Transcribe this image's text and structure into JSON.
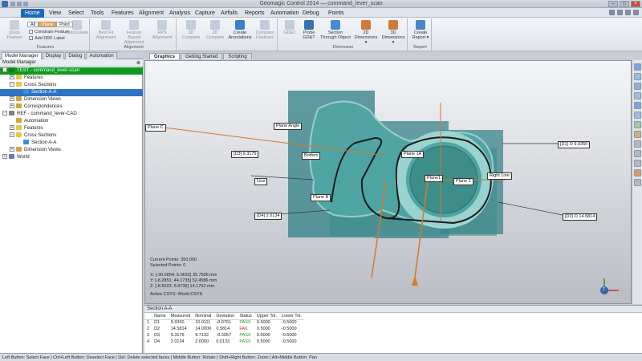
{
  "window": {
    "title": "Geomagic Control 2014 — command_lever_scan"
  },
  "menu": {
    "tabs": [
      "Home",
      "View",
      "Select",
      "Tools",
      "Features",
      "Alignment",
      "Analysis",
      "Capture",
      "Airfoils",
      "Reports",
      "Automation",
      "Debug",
      "Points"
    ],
    "active": "Home"
  },
  "ribbon": {
    "groups": [
      {
        "label": "Features",
        "buttons": [
          "Quick Feature",
          "AutoCreate"
        ],
        "checks": [
          "Constrain Feature",
          "Add DRF Label"
        ],
        "segments": [
          "All",
          "Plane",
          "Point"
        ],
        "active_segment": "Plane"
      },
      {
        "label": "Alignment",
        "buttons": [
          "Best Fit Alignment",
          "Feature Based Alignment",
          "RPS Alignment"
        ]
      },
      {
        "label": "",
        "buttons": [
          "3D Compare",
          "2D Compare",
          "Create Annotations",
          "Compare Features"
        ]
      },
      {
        "label": "Dimension",
        "buttons": [
          "GD&T",
          "Probe GD&T",
          "Section Through Object",
          "2D Dimensions ▾",
          "3D Dimensions ▾"
        ]
      },
      {
        "label": "Report",
        "buttons": [
          "Create Report ▾"
        ]
      }
    ]
  },
  "panel": {
    "tabs": [
      "Model Manager",
      "Display",
      "Dialog",
      "Automation"
    ],
    "header": "Model Manager",
    "tree": [
      {
        "label": "TEST - command_lever-scan",
        "level": 0,
        "expander": "−",
        "style": "test",
        "icon": "#0b7f17"
      },
      {
        "label": "Features",
        "level": 1,
        "expander": "+",
        "icon": "#e8c840"
      },
      {
        "label": "Cross Sections",
        "level": 1,
        "expander": "−",
        "icon": "#e8c840"
      },
      {
        "label": "Section A-A",
        "level": 2,
        "expander": "",
        "style": "sel",
        "icon": "#3a8dd8"
      },
      {
        "label": "Dimension Views",
        "level": 1,
        "expander": "+",
        "icon": "#d4a43c"
      },
      {
        "label": "Correspondences",
        "level": 1,
        "expander": "+",
        "icon": "#d4a43c"
      },
      {
        "label": "REF - command_lever-CAD",
        "level": 0,
        "expander": "−",
        "style": "ref",
        "icon": "#7a7f8a"
      },
      {
        "label": "Automation",
        "level": 1,
        "expander": "",
        "icon": "#d4a43c"
      },
      {
        "label": "Features",
        "level": 1,
        "expander": "+",
        "icon": "#e8c840"
      },
      {
        "label": "Cross Sections",
        "level": 1,
        "expander": "−",
        "icon": "#e8c840"
      },
      {
        "label": "Section A-A",
        "level": 2,
        "expander": "",
        "icon": "#3a8dd8"
      },
      {
        "label": "Dimension Views",
        "level": 1,
        "expander": "+",
        "icon": "#d4a43c"
      },
      {
        "label": "World",
        "level": 0,
        "expander": "+",
        "icon": "#5b7fb8"
      }
    ]
  },
  "graphics_tabs": [
    "Graphics",
    "Getting Started",
    "Scripting"
  ],
  "viewport": {
    "info": {
      "current_points": "Current Points: 350,000",
      "selected_points": "Selected Points: 0",
      "x": "X:  [-30.6854; 5.0652] 35.7506 mm",
      "y": "Y:  [-8.2851; 44.1735] 52.4586 mm",
      "z": "Z:  [-8.5023; 5.6739] 14.1762 mm",
      "csys": "Active CSYS: World CSYS"
    },
    "callouts": {
      "plane_c": "Plane C",
      "plane_angle": "Plane Angle",
      "d3": "[D3] 9.3175",
      "bottom": "Bottom",
      "plane_1a": "Plane 1A",
      "plane1": "Plane1",
      "plane_2": "Plane 2",
      "plane_b": "Plane B",
      "d4": "[D4] 2.0134",
      "d1": "[D1] O 9.9350",
      "right_line": "Right Line",
      "d2": "[D2] O 14.5814",
      "line": "Line"
    },
    "axes": {
      "x": "X",
      "y": "Y",
      "z": "Z"
    }
  },
  "results": {
    "title": "Section A-A",
    "columns": [
      "",
      "Name",
      "Measured",
      "Nominal",
      "Deviation",
      "Status",
      "Upper Tol.",
      "Lower Tol."
    ],
    "rows": [
      [
        "1",
        "D1",
        "9.9350",
        "10.0111",
        "-0.0761",
        "PASS",
        "0.5000",
        "-0.5000"
      ],
      [
        "2",
        "D2",
        "14.5814",
        "14.0000",
        "0.5814",
        "FAIL",
        "0.5000",
        "-0.5000"
      ],
      [
        "3",
        "D3",
        "9.3175",
        "9.7132",
        "-0.3957",
        "PASS",
        "0.5000",
        "-0.5000"
      ],
      [
        "4",
        "D4",
        "2.0134",
        "2.0000",
        "0.0133",
        "PASS",
        "0.5000",
        "-0.5000"
      ]
    ]
  },
  "status": "Left Button: Select Face | Ctrl+Left Button: Deselect Face | Del: Delete selected faces | Middle Button: Rotate | Shift+Right Button: Zoom | Alt+Middle Button: Pan"
}
